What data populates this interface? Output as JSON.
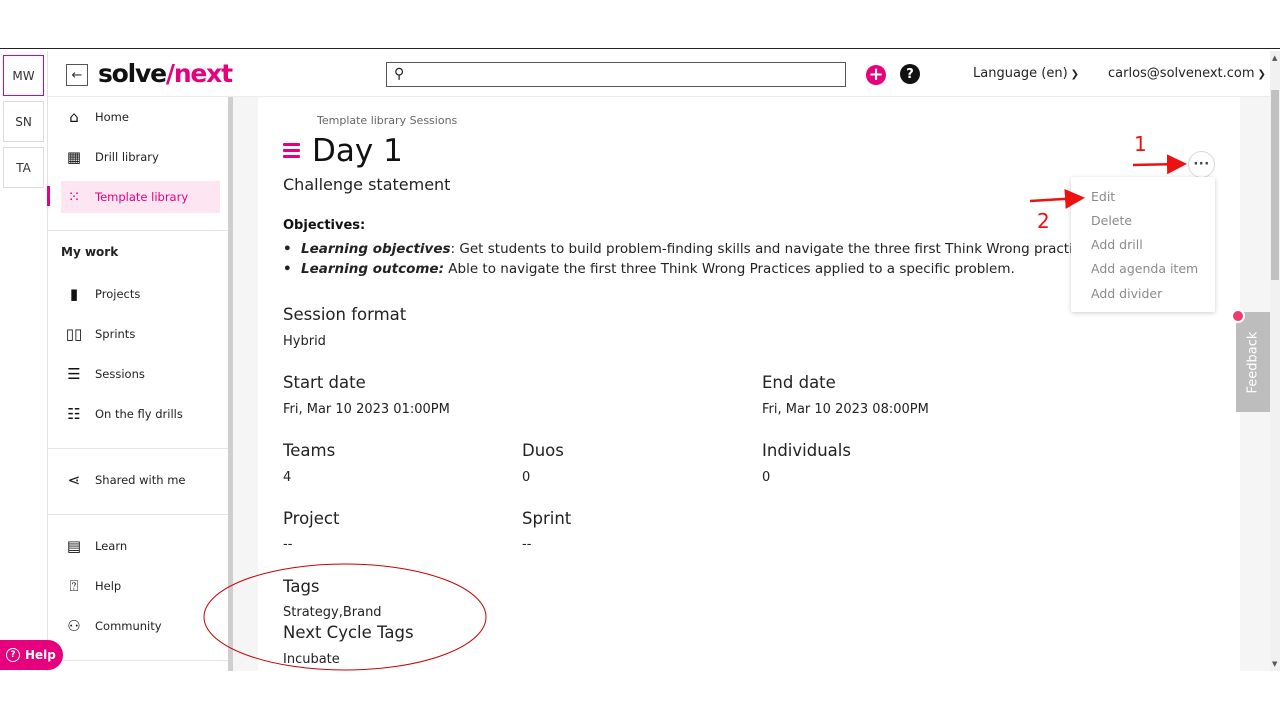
{
  "workspaces": [
    "MW",
    "SN",
    "TA"
  ],
  "header": {
    "logo_part1": "solve",
    "logo_part2": "/next",
    "search_placeholder": "",
    "language": "Language (en)",
    "user": "carlos@solvenext.com"
  },
  "sidebar": {
    "top_items": [
      {
        "label": "Home",
        "icon": "home-icon"
      },
      {
        "label": "Drill library",
        "icon": "grid-icon"
      },
      {
        "label": "Template library",
        "icon": "template-grid-icon"
      }
    ],
    "my_work_heading": "My work",
    "work_items": [
      {
        "label": "Projects",
        "icon": "bookmark-icon"
      },
      {
        "label": "Sprints",
        "icon": "columns-icon"
      },
      {
        "label": "Sessions",
        "icon": "list-icon"
      },
      {
        "label": "On the fly drills",
        "icon": "checklist-icon"
      }
    ],
    "shared": {
      "label": "Shared with me",
      "icon": "share-icon"
    },
    "bottom_items": [
      {
        "label": "Learn",
        "icon": "book-icon"
      },
      {
        "label": "Help",
        "icon": "question-icon"
      },
      {
        "label": "Community",
        "icon": "people-icon"
      }
    ],
    "help_pill": "Help"
  },
  "main": {
    "breadcrumb": "Template library Sessions",
    "title": "Day 1",
    "subtitle": "Challenge statement",
    "objectives_heading": "Objectives:",
    "objectives": [
      {
        "label": "Learning objectives",
        "sep": ":",
        "text": " Get students to build problem-finding skills and navigate the three first Think Wrong practices."
      },
      {
        "label": "Learning outcome:",
        "sep": "",
        "text": " Able to navigate the first three Think Wrong Practices applied to a specific problem."
      }
    ],
    "session_format_label": "Session format",
    "session_format_value": "Hybrid",
    "start_date_label": "Start date",
    "start_date_value": "Fri, Mar 10 2023 01:00PM",
    "end_date_label": "End date",
    "end_date_value": "Fri, Mar 10 2023 08:00PM",
    "teams_label": "Teams",
    "teams_value": "4",
    "duos_label": "Duos",
    "duos_value": "0",
    "individuals_label": "Individuals",
    "individuals_value": "0",
    "project_label": "Project",
    "project_value": "--",
    "sprint_label": "Sprint",
    "sprint_value": "--",
    "tags_label": "Tags",
    "tags_value": "Strategy,Brand",
    "next_cycle_tags_label": "Next Cycle Tags",
    "next_cycle_tags_value": "Incubate"
  },
  "more_button": "···",
  "dropdown": [
    "Edit",
    "Delete",
    "Add drill",
    "Add agenda item",
    "Add divider"
  ],
  "feedback": "Feedback",
  "annotations": [
    "1",
    "2"
  ],
  "colors": {
    "brand": "#e6007e",
    "annotation": "#e11111"
  }
}
